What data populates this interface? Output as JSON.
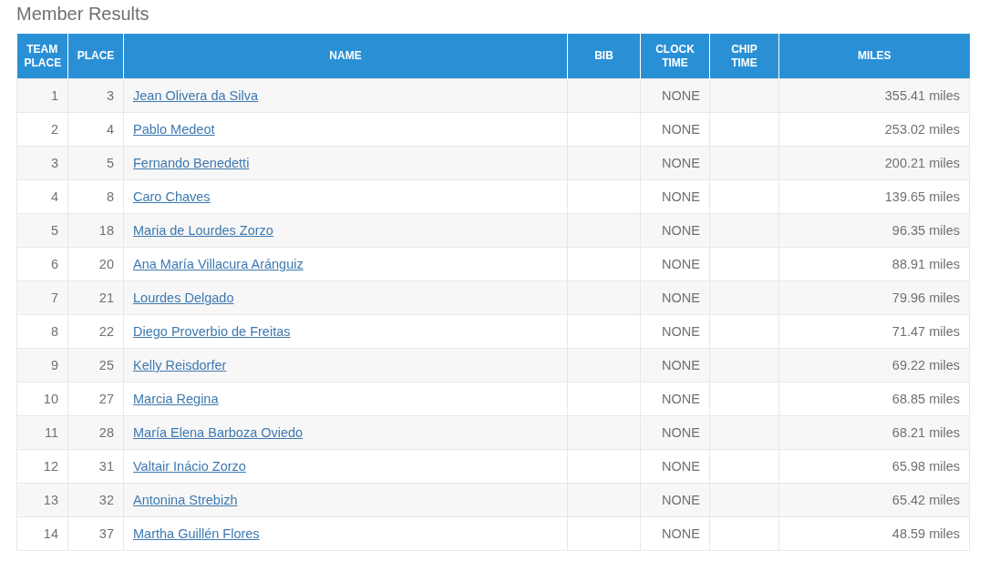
{
  "title": "Member Results",
  "table": {
    "columns": [
      "TEAM PLACE",
      "PLACE",
      "NAME",
      "BIB",
      "CLOCK TIME",
      "CHIP TIME",
      "MILES"
    ],
    "rows": [
      {
        "team_place": "1",
        "place": "3",
        "name": "Jean Olivera da Silva",
        "clock_time": "NONE",
        "miles": "355.41 miles"
      },
      {
        "team_place": "2",
        "place": "4",
        "name": "Pablo Medeot",
        "clock_time": "NONE",
        "miles": "253.02 miles"
      },
      {
        "team_place": "3",
        "place": "5",
        "name": "Fernando Benedetti",
        "clock_time": "NONE",
        "miles": "200.21 miles"
      },
      {
        "team_place": "4",
        "place": "8",
        "name": "Caro Chaves",
        "clock_time": "NONE",
        "miles": "139.65 miles"
      },
      {
        "team_place": "5",
        "place": "18",
        "name": "Maria de Lourdes Zorzo",
        "clock_time": "NONE",
        "miles": "96.35 miles"
      },
      {
        "team_place": "6",
        "place": "20",
        "name": "Ana María Villacura Aránguiz",
        "clock_time": "NONE",
        "miles": "88.91 miles"
      },
      {
        "team_place": "7",
        "place": "21",
        "name": "Lourdes Delgado",
        "clock_time": "NONE",
        "miles": "79.96 miles"
      },
      {
        "team_place": "8",
        "place": "22",
        "name": "Diego Proverbio de Freitas",
        "clock_time": "NONE",
        "miles": "71.47 miles"
      },
      {
        "team_place": "9",
        "place": "25",
        "name": "Kelly Reisdorfer",
        "clock_time": "NONE",
        "miles": "69.22 miles"
      },
      {
        "team_place": "10",
        "place": "27",
        "name": "Marcia Regina",
        "clock_time": "NONE",
        "miles": "68.85 miles"
      },
      {
        "team_place": "11",
        "place": "28",
        "name": "María Elena Barboza Oviedo",
        "clock_time": "NONE",
        "miles": "68.21 miles"
      },
      {
        "team_place": "12",
        "place": "31",
        "name": "Valtair Inácio Zorzo",
        "clock_time": "NONE",
        "miles": "65.98 miles"
      },
      {
        "team_place": "13",
        "place": "32",
        "name": "Antonina Strebizh",
        "clock_time": "NONE",
        "miles": "65.42 miles"
      },
      {
        "team_place": "14",
        "place": "37",
        "name": "Martha Guillén Flores",
        "clock_time": "NONE",
        "miles": "48.59 miles"
      }
    ]
  }
}
